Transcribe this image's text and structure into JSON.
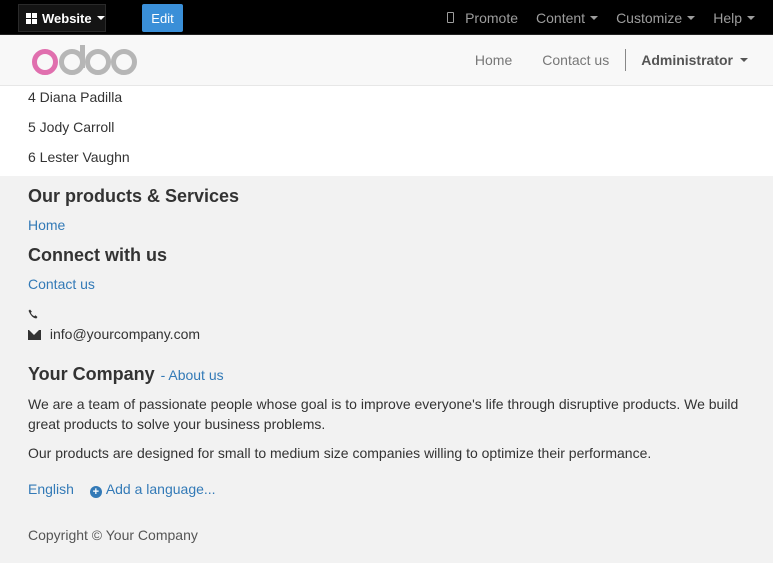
{
  "adminbar": {
    "website_label": "Website",
    "edit_label": "Edit",
    "promote_label": "Promote",
    "content_label": "Content",
    "customize_label": "Customize",
    "help_label": "Help"
  },
  "header": {
    "logo_text": "odoo",
    "nav_home": "Home",
    "nav_contact": "Contact us",
    "user_label": "Administrator"
  },
  "list": {
    "rows": [
      "4 Diana Padilla",
      "5 Jody Carroll",
      "6 Lester Vaughn"
    ]
  },
  "footer": {
    "products_heading": "Our products & Services",
    "products_link": "Home",
    "connect_heading": "Connect with us",
    "connect_link": "Contact us",
    "phone": "",
    "email": "info@yourcompany.com",
    "company_heading": "Your Company",
    "about_link": "- About us",
    "about_text_1": "We are a team of passionate people whose goal is to improve everyone's life through disruptive products. We build great products to solve your business problems.",
    "about_text_2": "Our products are designed for small to medium size companies willing to optimize their performance.",
    "lang_current": "English",
    "lang_add": "Add a language...",
    "copyright": "Copyright © Your Company"
  },
  "colors": {
    "link": "#337ab7",
    "edit_button": "#3a8fd8",
    "logo_pink": "#e06fae",
    "logo_gray": "#b6b6b6"
  }
}
